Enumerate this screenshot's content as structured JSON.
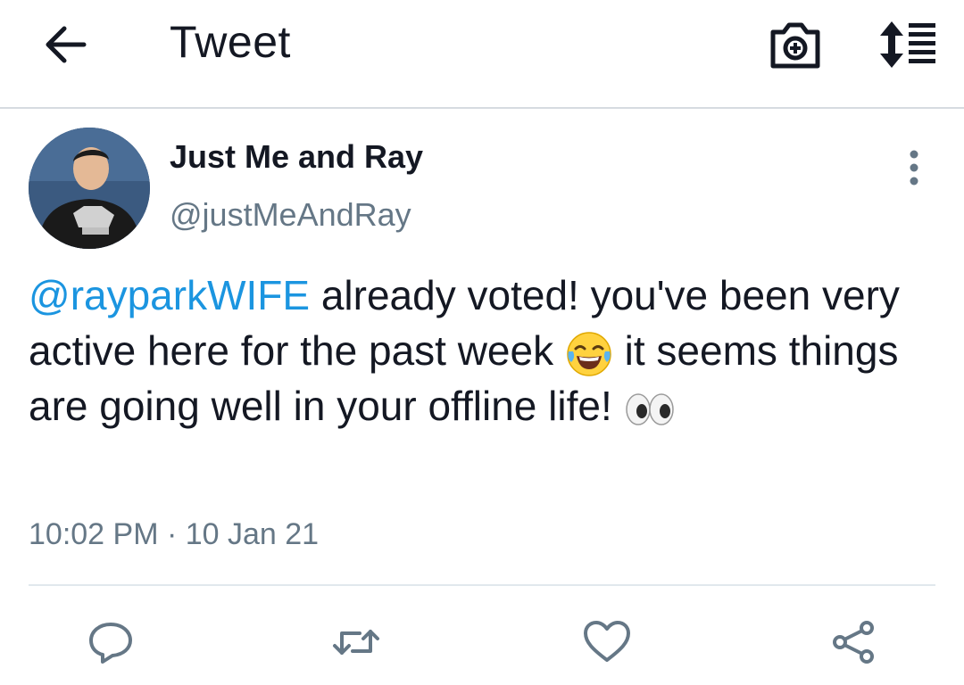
{
  "appbar": {
    "title": "Tweet",
    "icons": [
      "back-arrow-icon",
      "camera-add-icon",
      "sort-order-icon"
    ]
  },
  "tweet": {
    "author_name": "Just Me and Ray",
    "author_handle": "@justMeAndRay",
    "mention": "@rayparkWIFE",
    "text_part1": " already voted! you've been very active here for the past week ",
    "emoji1": "face-with-tears-of-joy",
    "text_part2": " it seems things are going well in your offline life! ",
    "emoji2": "eyes",
    "timestamp": "10:02 PM · 10 Jan 21"
  },
  "actions": [
    "reply-icon",
    "retweet-icon",
    "heart-icon",
    "share-icon"
  ],
  "colors": {
    "mention": "#1b95e0",
    "secondary_text": "#657786",
    "primary_text": "#141823",
    "icon": "#657786"
  }
}
